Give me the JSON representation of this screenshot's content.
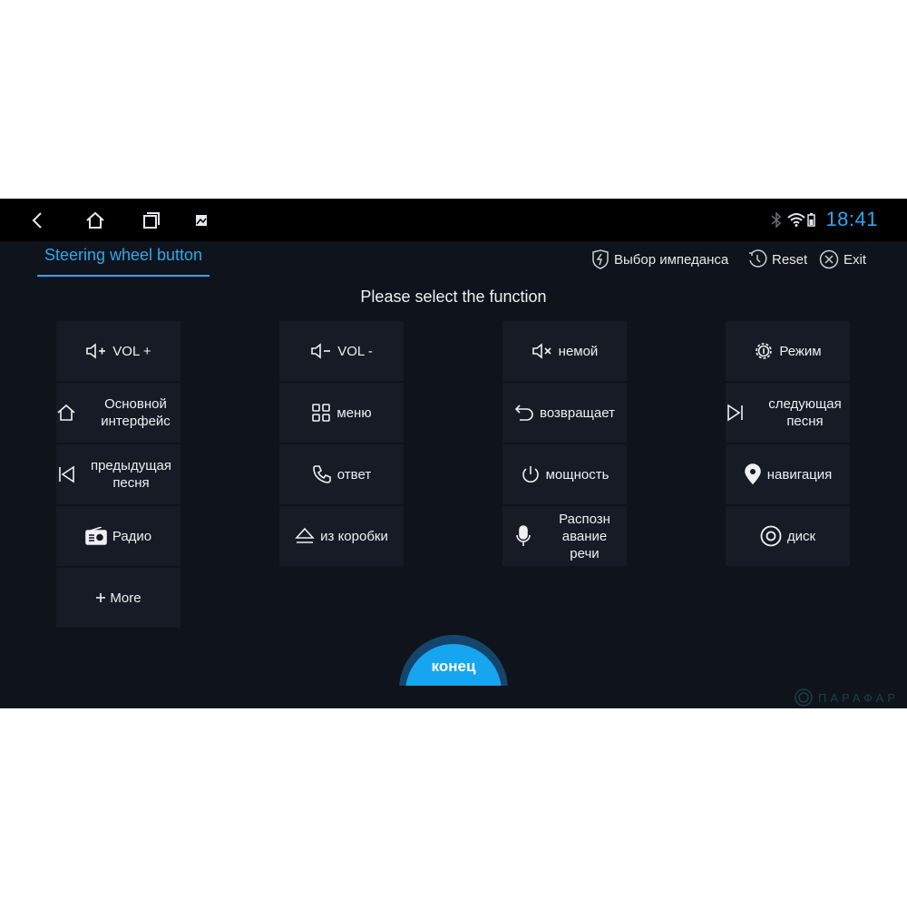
{
  "status_bar": {
    "time": "18:41",
    "icons": [
      "back-icon",
      "home-icon",
      "recents-icon",
      "screenshot-icon",
      "bluetooth-icon",
      "wifi-icon",
      "battery-icon"
    ]
  },
  "header": {
    "tab_title": "Steering wheel button",
    "impedance_label": "Выбор импеданса",
    "reset_label": "Reset",
    "exit_label": "Exit"
  },
  "prompt": "Please select the function",
  "functions": [
    {
      "label": "VOL +",
      "icon": "volume-up-icon"
    },
    {
      "label": "VOL -",
      "icon": "volume-down-icon"
    },
    {
      "label": "немой",
      "icon": "mute-icon"
    },
    {
      "label": "Режим",
      "icon": "mode-icon"
    },
    {
      "label": "Основной интерфейс",
      "icon": "home-icon"
    },
    {
      "label": "меню",
      "icon": "menu-grid-icon"
    },
    {
      "label": "возвращает",
      "icon": "return-icon"
    },
    {
      "label": "следующая песня",
      "icon": "next-track-icon"
    },
    {
      "label": "предыдущая песня",
      "icon": "prev-track-icon"
    },
    {
      "label": "ответ",
      "icon": "phone-icon"
    },
    {
      "label": "мощность",
      "icon": "power-icon"
    },
    {
      "label": "навигация",
      "icon": "location-pin-icon"
    },
    {
      "label": "Радио",
      "icon": "radio-icon"
    },
    {
      "label": "из коробки",
      "icon": "eject-icon"
    },
    {
      "label": "Распозн авание речи",
      "icon": "microphone-icon"
    },
    {
      "label": "диск",
      "icon": "disc-icon"
    },
    {
      "label": "More",
      "icon": "plus-icon"
    }
  ],
  "end_button_label": "конец",
  "watermark": "ПАРАФАР",
  "colors": {
    "accent": "#29a9ee",
    "background": "#0f131c",
    "cell": "#161b25",
    "end_button": "#16a6ef"
  }
}
